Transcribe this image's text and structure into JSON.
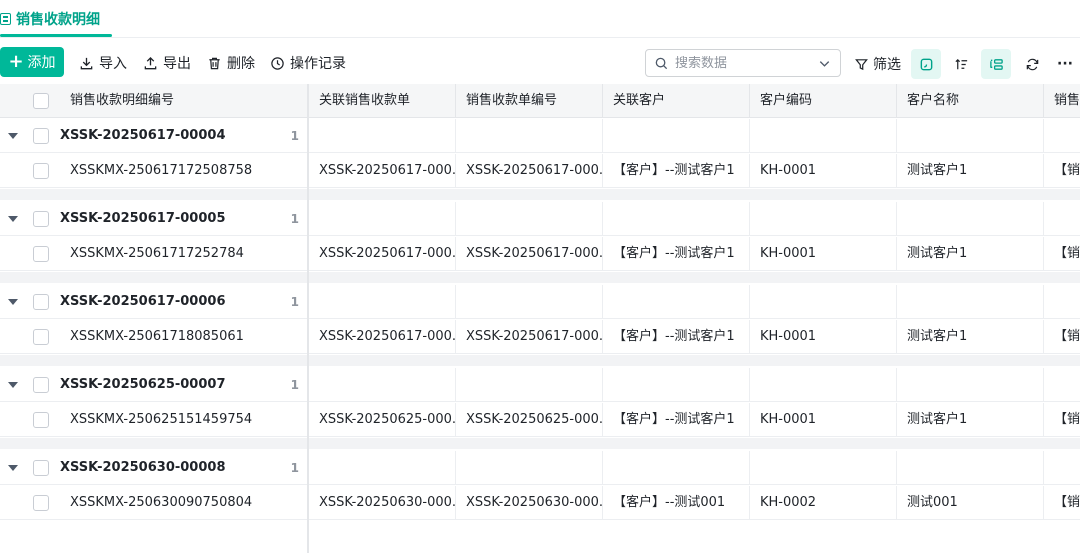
{
  "tab": {
    "label": "销售收款明细"
  },
  "toolbar": {
    "add_label": "添加",
    "import_label": "导入",
    "export_label": "导出",
    "delete_label": "删除",
    "log_label": "操作记录",
    "search_placeholder": "搜索数据",
    "filter_label": "筛选",
    "more_label": "···"
  },
  "table": {
    "columns": [
      "销售收款明细编号",
      "关联销售收款单",
      "销售收款单编号",
      "关联客户",
      "客户编码",
      "客户名称",
      "销售"
    ],
    "groups": [
      {
        "title": "XSSK-20250617-00004",
        "count": "1",
        "row": {
          "id": "XSSKMX-250617172508758",
          "order": "XSSK-20250617-000...",
          "order_no": "XSSK-20250617-000...",
          "customer": "【客户】--测试客户1",
          "code": "KH-0001",
          "name": "测试客户1",
          "sales": "【销"
        }
      },
      {
        "title": "XSSK-20250617-00005",
        "count": "1",
        "row": {
          "id": "XSSKMX-25061717252784",
          "order": "XSSK-20250617-000...",
          "order_no": "XSSK-20250617-000...",
          "customer": "【客户】--测试客户1",
          "code": "KH-0001",
          "name": "测试客户1",
          "sales": "【销"
        }
      },
      {
        "title": "XSSK-20250617-00006",
        "count": "1",
        "row": {
          "id": "XSSKMX-25061718085061",
          "order": "XSSK-20250617-000...",
          "order_no": "XSSK-20250617-000...",
          "customer": "【客户】--测试客户1",
          "code": "KH-0001",
          "name": "测试客户1",
          "sales": "【销"
        }
      },
      {
        "title": "XSSK-20250625-00007",
        "count": "1",
        "row": {
          "id": "XSSKMX-250625151459754",
          "order": "XSSK-20250625-000...",
          "order_no": "XSSK-20250625-000...",
          "customer": "【客户】--测试客户1",
          "code": "KH-0001",
          "name": "测试客户1",
          "sales": "【销"
        }
      },
      {
        "title": "XSSK-20250630-00008",
        "count": "1",
        "row": {
          "id": "XSSKMX-250630090750804",
          "order": "XSSK-20250630-000...",
          "order_no": "XSSK-20250630-000...",
          "customer": "【客户】--测试001",
          "code": "KH-0002",
          "name": "测试001",
          "sales": "【销"
        }
      }
    ]
  },
  "colors": {
    "accent": "#00b899",
    "accent_text": "#00a38a",
    "header_bg": "#f5f6f7",
    "separator": "#f2f3f5"
  }
}
